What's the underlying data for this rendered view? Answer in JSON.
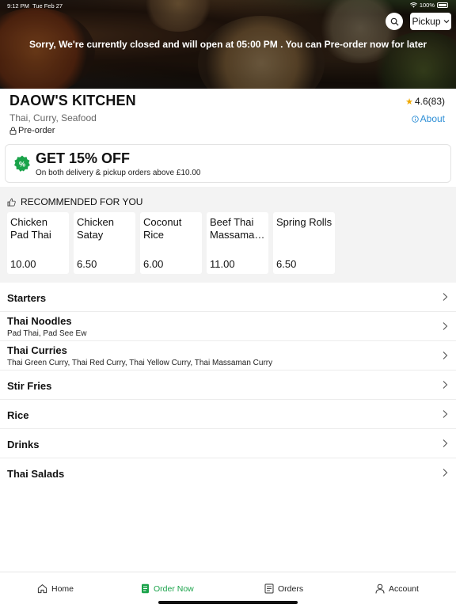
{
  "status_bar": {
    "time": "9:12 PM",
    "date": "Tue Feb 27",
    "battery": "100%"
  },
  "header": {
    "order_mode": "Pickup",
    "closed_message": "Sorry, We're currently closed and will open at 05:00 PM . You can Pre-order now for later"
  },
  "restaurant": {
    "name": "DAOW'S KITCHEN",
    "cuisines": "Thai, Curry, Seafood",
    "preorder_label": "Pre-order",
    "rating": "4.6(83)",
    "about_label": "About"
  },
  "promo": {
    "title": "GET 15% OFF",
    "subtitle": "On both delivery & pickup orders above £10.00",
    "badge_color": "#1aa34a"
  },
  "recommended": {
    "heading": "RECOMMENDED FOR YOU",
    "items": [
      {
        "name": "Chicken Pad Thai",
        "price": "10.00"
      },
      {
        "name": "Chicken Satay",
        "price": "6.50"
      },
      {
        "name": "Coconut Rice",
        "price": "6.00"
      },
      {
        "name": "Beef Thai Massaman Curry",
        "price": "11.00"
      },
      {
        "name": "Spring Rolls",
        "price": "6.50"
      }
    ]
  },
  "categories": [
    {
      "name": "Starters",
      "subtitle": ""
    },
    {
      "name": "Thai Noodles",
      "subtitle": "Pad Thai, Pad See Ew"
    },
    {
      "name": "Thai Curries",
      "subtitle": "Thai Green Curry, Thai Red Curry, Thai Yellow Curry, Thai Massaman Curry"
    },
    {
      "name": "Stir Fries",
      "subtitle": ""
    },
    {
      "name": "Rice",
      "subtitle": ""
    },
    {
      "name": "Drinks",
      "subtitle": ""
    },
    {
      "name": "Thai Salads",
      "subtitle": ""
    }
  ],
  "bottom_nav": {
    "home": "Home",
    "order_now": "Order Now",
    "orders": "Orders",
    "account": "Account",
    "active_color": "#1aa34a"
  }
}
